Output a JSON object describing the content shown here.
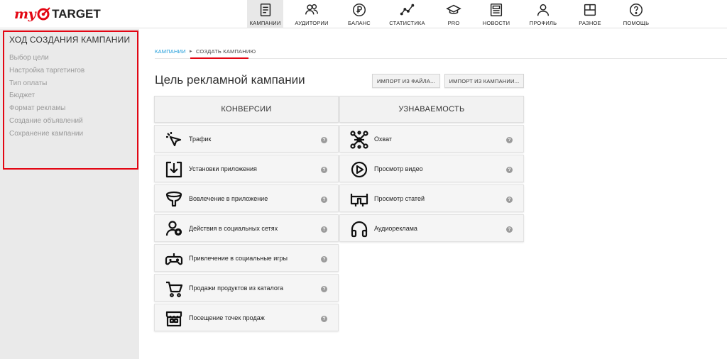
{
  "logo": {
    "my": "my",
    "target": "TARGET"
  },
  "nav": [
    {
      "label": "КАМПАНИИ",
      "icon": "campaigns-icon",
      "active": true
    },
    {
      "label": "АУДИТОРИИ",
      "icon": "audiences-icon"
    },
    {
      "label": "БАЛАНС",
      "icon": "ruble-icon"
    },
    {
      "label": "СТАТИСТИКА",
      "icon": "statistics-icon"
    },
    {
      "label": "PRO",
      "icon": "graduation-cap-icon"
    },
    {
      "label": "НОВОСТИ",
      "icon": "news-icon"
    },
    {
      "label": "ПРОФИЛЬ",
      "icon": "profile-icon"
    },
    {
      "label": "РАЗНОЕ",
      "icon": "misc-icon"
    },
    {
      "label": "ПОМОЩЬ",
      "icon": "help-icon"
    }
  ],
  "sidebar": {
    "title": "ХОД СОЗДАНИЯ КАМПАНИИ",
    "steps": [
      "Выбор цели",
      "Настройка таргетингов",
      "Тип оплаты",
      "Бюджет",
      "Формат рекламы",
      "Создание объявлений",
      "Сохранение кампании"
    ]
  },
  "breadcrumb": {
    "root": "КАМПАНИИ",
    "current": "СОЗДАТЬ КАМПАНИЮ"
  },
  "page": {
    "title": "Цель рекламной кампании",
    "import_file": "ИМПОРТ ИЗ ФАЙЛА...",
    "import_campaign": "ИМПОРТ ИЗ КАМПАНИИ..."
  },
  "columns": {
    "conversions": {
      "title": "КОНВЕРСИИ",
      "goals": [
        {
          "label": "Трафик",
          "icon": "cursor-click-icon"
        },
        {
          "label": "Установки приложения",
          "icon": "download-box-icon"
        },
        {
          "label": "Вовлечение в приложение",
          "icon": "funnel-icon"
        },
        {
          "label": "Действия в социальных сетях",
          "icon": "social-users-icon"
        },
        {
          "label": "Привлечение в социальные игры",
          "icon": "gamepad-icon"
        },
        {
          "label": "Продажи продуктов из каталога",
          "icon": "cart-icon"
        },
        {
          "label": "Посещение точек продаж",
          "icon": "store-icon"
        }
      ]
    },
    "awareness": {
      "title": "УЗНАВАЕМОСТЬ",
      "goals": [
        {
          "label": "Охват",
          "icon": "reach-network-icon"
        },
        {
          "label": "Просмотр видео",
          "icon": "play-circle-icon"
        },
        {
          "label": "Просмотр статей",
          "icon": "reading-glasses-icon"
        },
        {
          "label": "Аудиореклама",
          "icon": "headphones-icon"
        }
      ]
    }
  },
  "help_glyph": "?",
  "colors": {
    "accent": "#e30613",
    "link": "#1a9ad9",
    "sidebar_bg": "#eaeaea"
  }
}
